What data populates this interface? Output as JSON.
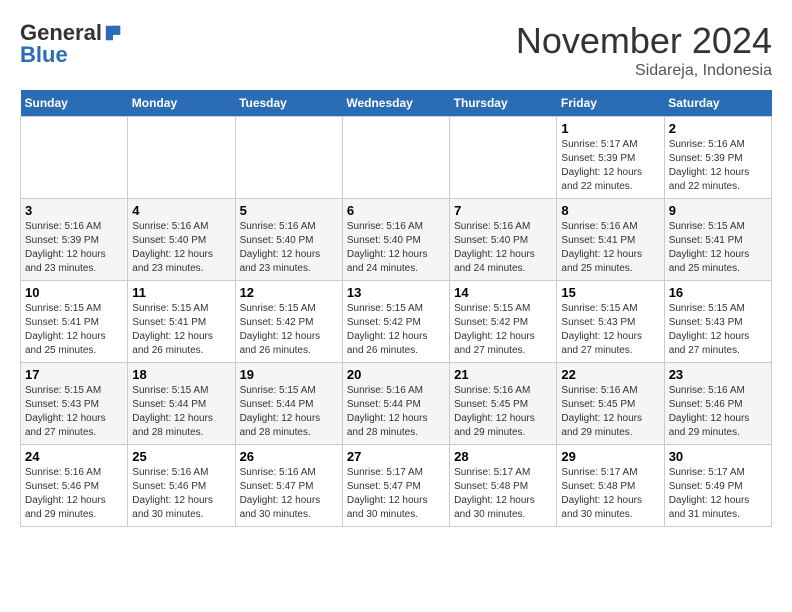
{
  "logo": {
    "general": "General",
    "blue": "Blue"
  },
  "title": "November 2024",
  "location": "Sidareja, Indonesia",
  "days_header": [
    "Sunday",
    "Monday",
    "Tuesday",
    "Wednesday",
    "Thursday",
    "Friday",
    "Saturday"
  ],
  "weeks": [
    [
      {
        "day": "",
        "info": ""
      },
      {
        "day": "",
        "info": ""
      },
      {
        "day": "",
        "info": ""
      },
      {
        "day": "",
        "info": ""
      },
      {
        "day": "",
        "info": ""
      },
      {
        "day": "1",
        "info": "Sunrise: 5:17 AM\nSunset: 5:39 PM\nDaylight: 12 hours and 22 minutes."
      },
      {
        "day": "2",
        "info": "Sunrise: 5:16 AM\nSunset: 5:39 PM\nDaylight: 12 hours and 22 minutes."
      }
    ],
    [
      {
        "day": "3",
        "info": "Sunrise: 5:16 AM\nSunset: 5:39 PM\nDaylight: 12 hours and 23 minutes."
      },
      {
        "day": "4",
        "info": "Sunrise: 5:16 AM\nSunset: 5:40 PM\nDaylight: 12 hours and 23 minutes."
      },
      {
        "day": "5",
        "info": "Sunrise: 5:16 AM\nSunset: 5:40 PM\nDaylight: 12 hours and 23 minutes."
      },
      {
        "day": "6",
        "info": "Sunrise: 5:16 AM\nSunset: 5:40 PM\nDaylight: 12 hours and 24 minutes."
      },
      {
        "day": "7",
        "info": "Sunrise: 5:16 AM\nSunset: 5:40 PM\nDaylight: 12 hours and 24 minutes."
      },
      {
        "day": "8",
        "info": "Sunrise: 5:16 AM\nSunset: 5:41 PM\nDaylight: 12 hours and 25 minutes."
      },
      {
        "day": "9",
        "info": "Sunrise: 5:15 AM\nSunset: 5:41 PM\nDaylight: 12 hours and 25 minutes."
      }
    ],
    [
      {
        "day": "10",
        "info": "Sunrise: 5:15 AM\nSunset: 5:41 PM\nDaylight: 12 hours and 25 minutes."
      },
      {
        "day": "11",
        "info": "Sunrise: 5:15 AM\nSunset: 5:41 PM\nDaylight: 12 hours and 26 minutes."
      },
      {
        "day": "12",
        "info": "Sunrise: 5:15 AM\nSunset: 5:42 PM\nDaylight: 12 hours and 26 minutes."
      },
      {
        "day": "13",
        "info": "Sunrise: 5:15 AM\nSunset: 5:42 PM\nDaylight: 12 hours and 26 minutes."
      },
      {
        "day": "14",
        "info": "Sunrise: 5:15 AM\nSunset: 5:42 PM\nDaylight: 12 hours and 27 minutes."
      },
      {
        "day": "15",
        "info": "Sunrise: 5:15 AM\nSunset: 5:43 PM\nDaylight: 12 hours and 27 minutes."
      },
      {
        "day": "16",
        "info": "Sunrise: 5:15 AM\nSunset: 5:43 PM\nDaylight: 12 hours and 27 minutes."
      }
    ],
    [
      {
        "day": "17",
        "info": "Sunrise: 5:15 AM\nSunset: 5:43 PM\nDaylight: 12 hours and 27 minutes."
      },
      {
        "day": "18",
        "info": "Sunrise: 5:15 AM\nSunset: 5:44 PM\nDaylight: 12 hours and 28 minutes."
      },
      {
        "day": "19",
        "info": "Sunrise: 5:15 AM\nSunset: 5:44 PM\nDaylight: 12 hours and 28 minutes."
      },
      {
        "day": "20",
        "info": "Sunrise: 5:16 AM\nSunset: 5:44 PM\nDaylight: 12 hours and 28 minutes."
      },
      {
        "day": "21",
        "info": "Sunrise: 5:16 AM\nSunset: 5:45 PM\nDaylight: 12 hours and 29 minutes."
      },
      {
        "day": "22",
        "info": "Sunrise: 5:16 AM\nSunset: 5:45 PM\nDaylight: 12 hours and 29 minutes."
      },
      {
        "day": "23",
        "info": "Sunrise: 5:16 AM\nSunset: 5:46 PM\nDaylight: 12 hours and 29 minutes."
      }
    ],
    [
      {
        "day": "24",
        "info": "Sunrise: 5:16 AM\nSunset: 5:46 PM\nDaylight: 12 hours and 29 minutes."
      },
      {
        "day": "25",
        "info": "Sunrise: 5:16 AM\nSunset: 5:46 PM\nDaylight: 12 hours and 30 minutes."
      },
      {
        "day": "26",
        "info": "Sunrise: 5:16 AM\nSunset: 5:47 PM\nDaylight: 12 hours and 30 minutes."
      },
      {
        "day": "27",
        "info": "Sunrise: 5:17 AM\nSunset: 5:47 PM\nDaylight: 12 hours and 30 minutes."
      },
      {
        "day": "28",
        "info": "Sunrise: 5:17 AM\nSunset: 5:48 PM\nDaylight: 12 hours and 30 minutes."
      },
      {
        "day": "29",
        "info": "Sunrise: 5:17 AM\nSunset: 5:48 PM\nDaylight: 12 hours and 30 minutes."
      },
      {
        "day": "30",
        "info": "Sunrise: 5:17 AM\nSunset: 5:49 PM\nDaylight: 12 hours and 31 minutes."
      }
    ]
  ]
}
